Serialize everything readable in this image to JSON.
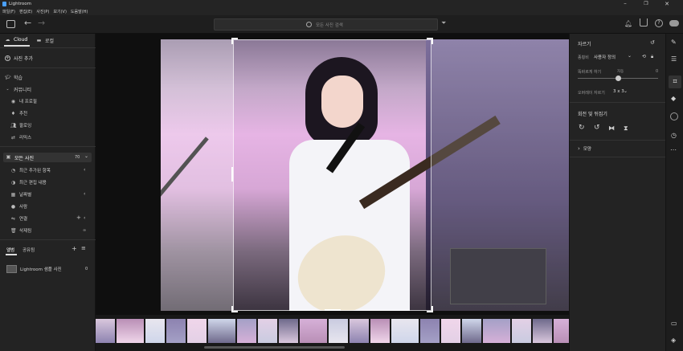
{
  "app": {
    "title": "Lightroom",
    "window_controls": [
      "minimize-icon",
      "restore-icon",
      "close-icon"
    ]
  },
  "menu": [
    "파일(F)",
    "편집(E)",
    "사진(P)",
    "보기(V)",
    "도움말(H)"
  ],
  "search": {
    "placeholder": "모든 사진 검색"
  },
  "left": {
    "tab_cloud": "Cloud",
    "tab_local": "로컬",
    "add_photos": "사진 추가",
    "learn": "학습",
    "community": "커뮤니티",
    "community_items": [
      "내 프로필",
      "추천",
      "팔로잉",
      "리믹스"
    ],
    "all_photos": "모든 사진",
    "all_photos_count": "70",
    "library_items": [
      "최근 추가된 항목",
      "최근 편집 내용",
      "날짜별",
      "사람",
      "연결",
      "삭제됨"
    ],
    "connected_badge": "∞",
    "tab_albums": "앨범",
    "tab_shared": "공유됨",
    "sample_album": "Lightroom 샘플 사진",
    "sample_count": "0"
  },
  "right": {
    "section_crop": "자르기",
    "aspect_label": "종횡비",
    "aspect_value": "사용자 정의",
    "straighten_label": "똑바르게 하기",
    "straighten_auto": "자동",
    "straighten_value": "0",
    "overlay_label": "오버레이 자르기",
    "overlay_value": "3 x 3",
    "section_rotate": "회전 및 뒤집기",
    "section_presets": "모양"
  },
  "colors": {
    "accent": "#4aa0ff",
    "panel": "#232323",
    "background": "#0f0f0f"
  },
  "filmstrip": {
    "count": 22
  }
}
